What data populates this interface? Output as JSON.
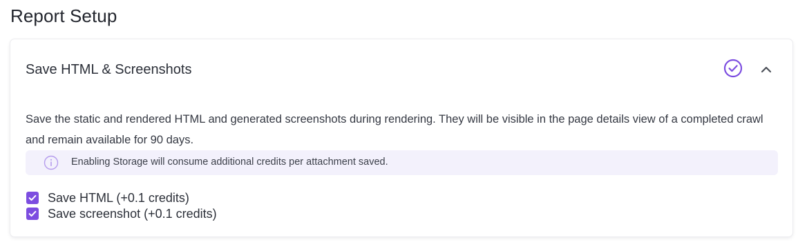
{
  "page": {
    "title": "Report Setup"
  },
  "section": {
    "title": "Save HTML & Screenshots",
    "status_icon": "check-circle-icon",
    "toggle_icon": "chevron-up-icon",
    "description": "Save the static and rendered HTML and generated screenshots during rendering. They will be visible in the page details view of a completed crawl and remain available for 90 days.",
    "info": {
      "icon": "info-icon",
      "text": "Enabling Storage will consume additional credits per attachment saved."
    },
    "options": [
      {
        "label": "Save HTML (+0.1 credits)",
        "checked": true
      },
      {
        "label": "Save screenshot (+0.1 credits)",
        "checked": true
      }
    ]
  },
  "colors": {
    "accent": "#7c4de0",
    "info_background": "#f3f1fc",
    "text": "#262a33"
  }
}
